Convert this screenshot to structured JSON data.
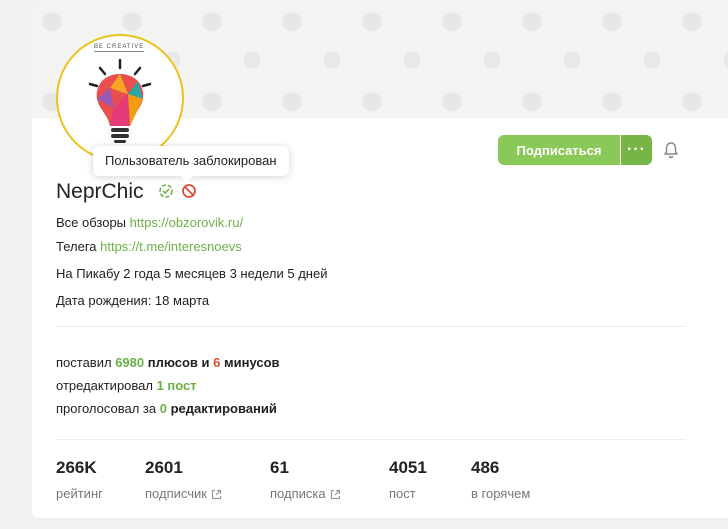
{
  "profile": {
    "username": "NeprChic",
    "avatar_tagline": "BE CREATIVE",
    "tooltip": "Пользователь заблокирован",
    "subscribe_label": "Подписаться",
    "more_label": "···",
    "about": [
      {
        "prefix": "Все обзоры ",
        "link": "https://obzorovik.ru/"
      },
      {
        "prefix": "Телега ",
        "link": "https://t.me/interesnoevs"
      }
    ],
    "on_site": "На Пикабу 2 года 5 месяцев 3 недели 5 дней",
    "birthday": "Дата рождения: 18 марта"
  },
  "activity": {
    "line1": {
      "a": "поставил ",
      "plus": "6980",
      "b": " плюсов и ",
      "minus": "6",
      "c": " минусов"
    },
    "line2": {
      "a": "отредактировал ",
      "count": "1 пост"
    },
    "line3": {
      "a": "проголосовал за ",
      "count": "0",
      "b": " редактирований"
    }
  },
  "counters": [
    {
      "value": "266K",
      "label": "рейтинг"
    },
    {
      "value": "2601",
      "label": "подписчик"
    },
    {
      "value": "61",
      "label": "подписка"
    },
    {
      "value": "4051",
      "label": "пост"
    },
    {
      "value": "486",
      "label": "в горячем"
    }
  ],
  "colors": {
    "accent": "#8ac858",
    "link": "#6bb046",
    "minus": "#dd4c3b",
    "avatar_border": "#ecc21d"
  },
  "icons": [
    "verified-icon",
    "banned-icon",
    "bell-icon",
    "external-link-icon"
  ]
}
